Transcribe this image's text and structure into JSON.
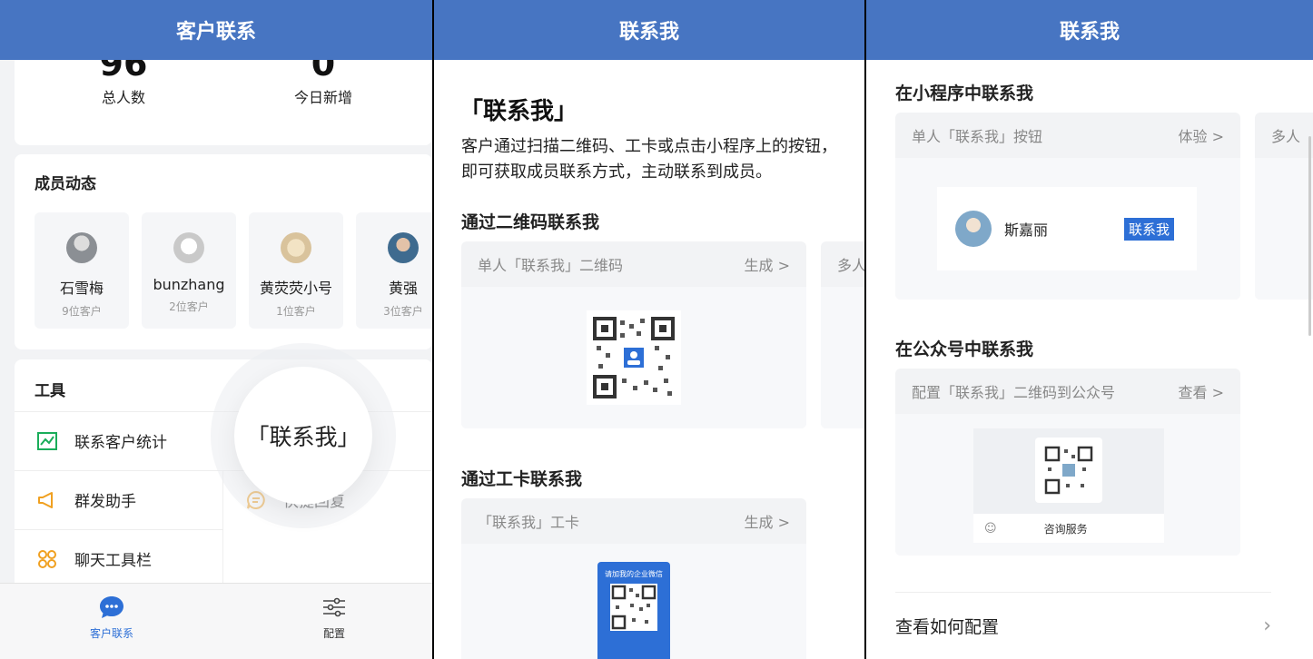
{
  "panel1": {
    "title": "客户联系",
    "stats": [
      {
        "num": "96",
        "label": "总人数"
      },
      {
        "num": "0",
        "label": "今日新增"
      }
    ],
    "members_title": "成员动态",
    "members": [
      {
        "name": "石雪梅",
        "count": "9位客户"
      },
      {
        "name": "bunzhang",
        "count": "2位客户"
      },
      {
        "name": "黄荧荧小号",
        "count": "1位客户"
      },
      {
        "name": "黄强",
        "count": "3位客户"
      }
    ],
    "tools_title": "工具",
    "tools": [
      {
        "label": "联系客户统计",
        "icon": "chart-icon"
      },
      {
        "label": "群发助手",
        "icon": "megaphone-icon"
      },
      {
        "label": "聊天工具栏",
        "icon": "toolbar-icon"
      },
      {
        "label": "快捷回复",
        "icon": "reply-icon"
      }
    ],
    "magnifier_text": "「联系我」",
    "tabs": [
      {
        "label": "客户联系",
        "active": true
      },
      {
        "label": "配置",
        "active": false
      }
    ],
    "colors": {
      "header": "#4775c2",
      "active_tab": "#2d6fd6"
    }
  },
  "panel2": {
    "title": "联系我",
    "heading": "「联系我」",
    "description": "客户通过扫描二维码、工卡或点击小程序上的按钮，即可获取成员联系方式，主动联系到成员。",
    "qr_section": "通过二维码联系我",
    "single_qr_label": "单人「联系我」二维码",
    "generate_label": "生成 >",
    "multi_qr_label": "多人",
    "card_section": "通过工卡联系我",
    "card_label": "「联系我」工卡",
    "card_generate_label": "生成 >",
    "work_card_caption": "请加我的企业微信"
  },
  "panel3": {
    "title": "联系我",
    "mini_section": "在小程序中联系我",
    "single_button_label": "单人「联系我」按钮",
    "try_label": "体验 >",
    "multi_label": "多人",
    "demo_name": "斯嘉丽",
    "demo_button": "联系我",
    "mp_section": "在公众号中联系我",
    "mp_config_label": "配置「联系我」二维码到公众号",
    "view_label": "查看 >",
    "service_label": "咨询服务",
    "howto_label": "查看如何配置",
    "howto_arrow": "›"
  }
}
